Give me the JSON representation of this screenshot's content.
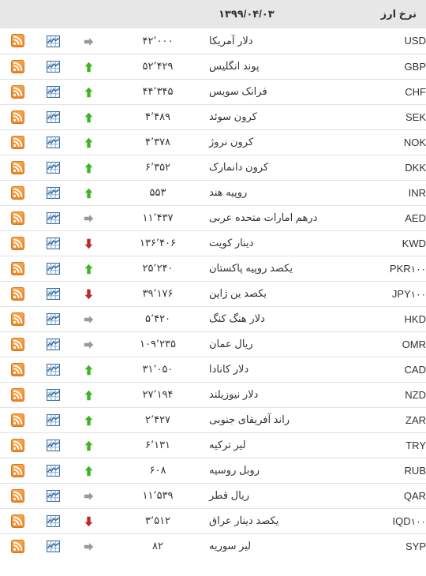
{
  "header": {
    "title": "نرخ ارز",
    "date": "۱۳۹۹/۰۴/۰۳",
    "trend_col": "",
    "chart_col": "",
    "rss_col": ""
  },
  "icons": {
    "rss": "rss-icon",
    "chart": "chart-icon",
    "up": "arrow-up-icon",
    "down": "arrow-down-icon",
    "flat": "arrow-right-icon"
  },
  "colors": {
    "header_bg": "#e7e7e7",
    "row_border": "#e2e2e2",
    "text": "#333333",
    "up": "#3cb521",
    "down": "#c0282d",
    "flat": "#999999",
    "rss_orange": "#f08422",
    "chart_blue": "#3a6ea5"
  },
  "rows": [
    {
      "code": "USD",
      "mult": "",
      "name": "دلار آمریکا",
      "rate": "۴۲٬۰۰۰",
      "trend": "flat"
    },
    {
      "code": "GBP",
      "mult": "",
      "name": "پوند انگلیس",
      "rate": "۵۲٬۴۲۹",
      "trend": "up"
    },
    {
      "code": "CHF",
      "mult": "",
      "name": "فرانک سویس",
      "rate": "۴۴٬۳۴۵",
      "trend": "up"
    },
    {
      "code": "SEK",
      "mult": "",
      "name": "کرون سوئد",
      "rate": "۴٬۴۸۹",
      "trend": "up"
    },
    {
      "code": "NOK",
      "mult": "",
      "name": "کرون نروژ",
      "rate": "۴٬۳۷۸",
      "trend": "up"
    },
    {
      "code": "DKK",
      "mult": "",
      "name": "کرون دانمارک",
      "rate": "۶٬۳۵۲",
      "trend": "up"
    },
    {
      "code": "INR",
      "mult": "",
      "name": "روپیه هند",
      "rate": "۵۵۳",
      "trend": "up"
    },
    {
      "code": "AED",
      "mult": "",
      "name": "درهم امارات متحده عربی",
      "rate": "۱۱٬۴۳۷",
      "trend": "flat"
    },
    {
      "code": "KWD",
      "mult": "",
      "name": "دینار کویت",
      "rate": "۱۳۶٬۴۰۶",
      "trend": "down"
    },
    {
      "code": "PKR",
      "mult": "۱۰۰",
      "name": "یکصد روپیه پاکستان",
      "rate": "۲۵٬۲۴۰",
      "trend": "up"
    },
    {
      "code": "JPY",
      "mult": "۱۰۰",
      "name": "یکصد ین ژاپن",
      "rate": "۳۹٬۱۷۶",
      "trend": "down"
    },
    {
      "code": "HKD",
      "mult": "",
      "name": "دلار هنگ کنگ",
      "rate": "۵٬۴۲۰",
      "trend": "flat"
    },
    {
      "code": "OMR",
      "mult": "",
      "name": "ریال عمان",
      "rate": "۱۰۹٬۲۳۵",
      "trend": "flat"
    },
    {
      "code": "CAD",
      "mult": "",
      "name": "دلار کانادا",
      "rate": "۳۱٬۰۵۰",
      "trend": "up"
    },
    {
      "code": "NZD",
      "mult": "",
      "name": "دلار نیوزیلند",
      "rate": "۲۷٬۱۹۴",
      "trend": "up"
    },
    {
      "code": "ZAR",
      "mult": "",
      "name": "راند آفریقای جنوبی",
      "rate": "۲٬۴۲۷",
      "trend": "up"
    },
    {
      "code": "TRY",
      "mult": "",
      "name": "لیر ترکیه",
      "rate": "۶٬۱۳۱",
      "trend": "up"
    },
    {
      "code": "RUB",
      "mult": "",
      "name": "روبل روسیه",
      "rate": "۶۰۸",
      "trend": "up"
    },
    {
      "code": "QAR",
      "mult": "",
      "name": "ریال قطر",
      "rate": "۱۱٬۵۳۹",
      "trend": "flat"
    },
    {
      "code": "IQD",
      "mult": "۱۰۰",
      "name": "یکصد دینار عراق",
      "rate": "۳٬۵۱۲",
      "trend": "down"
    },
    {
      "code": "SYP",
      "mult": "",
      "name": "لیر سوریه",
      "rate": "۸۲",
      "trend": "flat"
    }
  ]
}
